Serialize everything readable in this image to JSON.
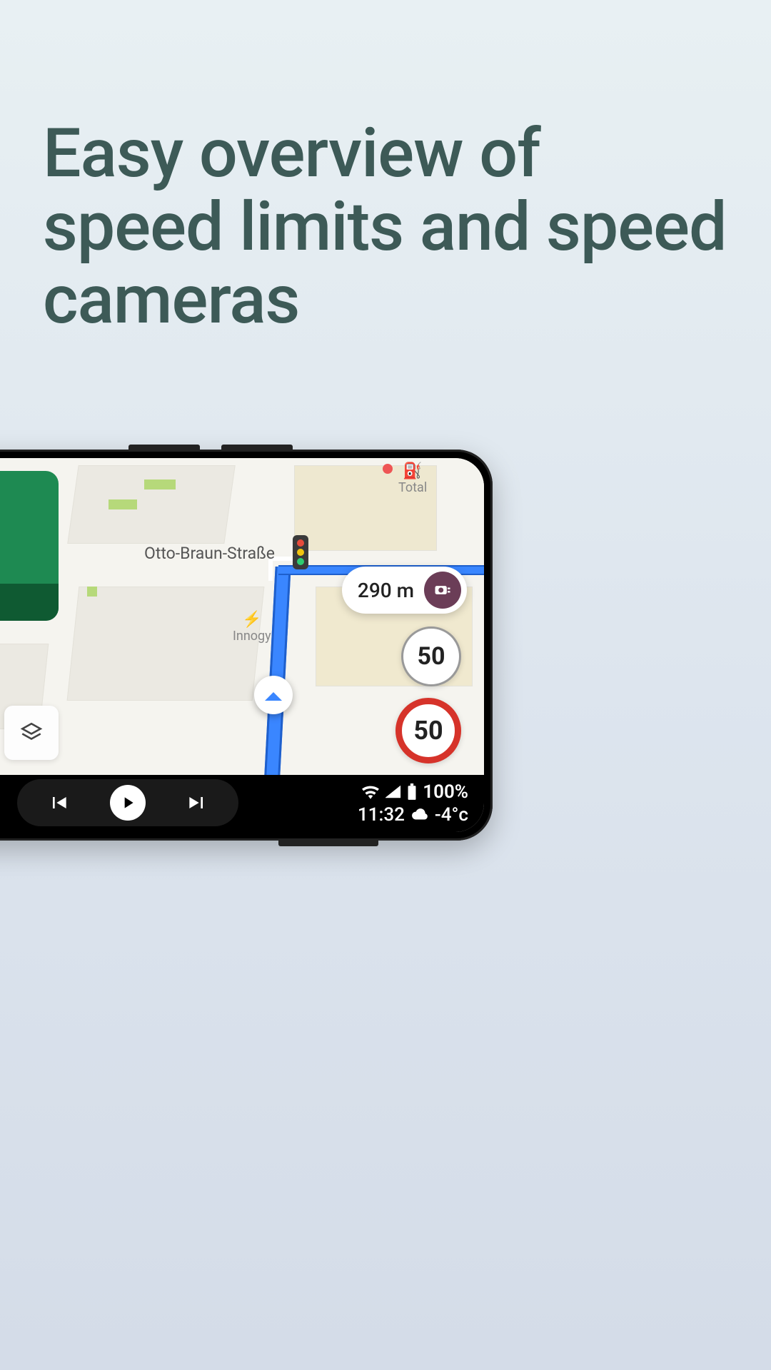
{
  "headline": "Easy overview of speed limits and speed cameras",
  "map": {
    "street_label": "Otto-Braun-Straße",
    "poi_innogy": "Innogy",
    "poi_total": "Total",
    "camera_distance": "290 m",
    "speed_upcoming": "50",
    "speed_current": "50"
  },
  "status": {
    "battery": "100%",
    "time": "11:32",
    "temp": "-4°c"
  },
  "icons": {
    "layers": "layers-icon",
    "camera": "speed-camera-icon",
    "wifi": "wifi-icon",
    "cell": "cellular-icon",
    "battery": "battery-icon",
    "cloud": "cloud-icon",
    "prev": "previous-track-icon",
    "play": "play-icon",
    "next": "next-track-icon",
    "gas": "gas-station-icon",
    "ev": "ev-station-icon"
  }
}
